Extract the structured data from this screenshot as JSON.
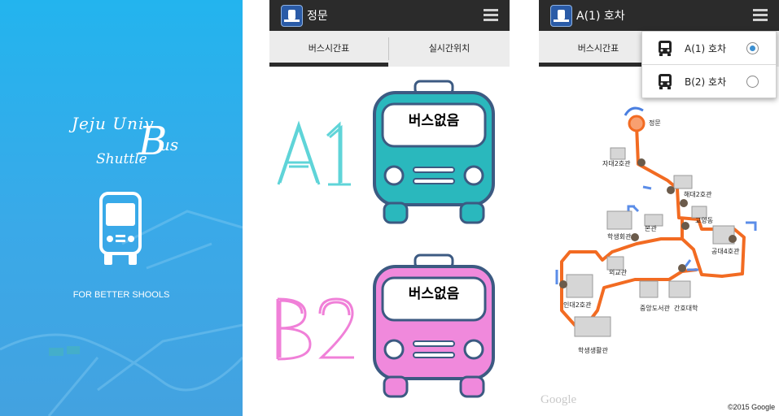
{
  "splash": {
    "logo_line1": "Jeju Univ",
    "logo_line2": "Shuttle",
    "logo_bus": "us",
    "logo_B": "B",
    "slogan": "FOR BETTER SHOOLS"
  },
  "schedule_screen": {
    "title": "정문",
    "tabs": [
      "버스시간표",
      "실시간위치"
    ],
    "active_tab": 0,
    "buses": [
      {
        "route": "A1",
        "status": "버스없음",
        "color": "#2ab8bd",
        "route_color": "#5fd4d8"
      },
      {
        "route": "B2",
        "status": "버스없음",
        "color": "#f089dc",
        "route_color": "#f080d8"
      }
    ]
  },
  "map_screen": {
    "title": "A(1) 호차",
    "tab_visible": "버스시간표",
    "menu_options": [
      {
        "label": "A(1) 호차",
        "selected": true
      },
      {
        "label": "B(2) 호차",
        "selected": false
      }
    ],
    "stops": [
      "정문",
      "자대2호관",
      "해대2호관",
      "교양동",
      "본관",
      "학생회관",
      "공대4호관",
      "외교관",
      "인대2호관",
      "중앙도서관",
      "간호대학",
      "학생생활관"
    ],
    "route_color": "#f26b22",
    "google_logo": "Google",
    "copyright": "©2015 Google"
  }
}
